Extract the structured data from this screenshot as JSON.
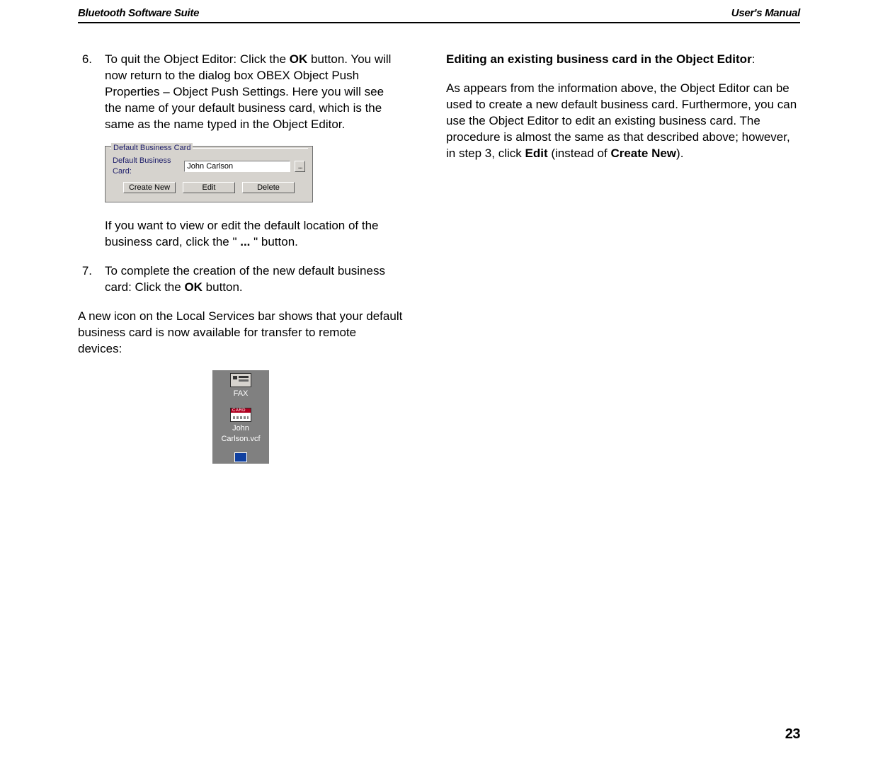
{
  "header": {
    "left": "Bluetooth Software Suite",
    "right": "User's Manual"
  },
  "left": {
    "item6": {
      "num": "6.",
      "text_before_ok": "To quit the Object Editor: Click the ",
      "ok": "OK",
      "text_after_ok": " button. You will now return to the dialog box OBEX Object Push Properties – Object Push Settings. Here you will see the name of your default business card, which is the same as the name typed in the Object Editor."
    },
    "dbc": {
      "group_label": "Default Business Card",
      "field_label": "Default Business Card:",
      "value": "John Carlson",
      "browse": "...",
      "create": "Create New",
      "edit": "Edit",
      "delete": "Delete"
    },
    "para_after_image_before_bold": "If you want to view or edit the default location of the business card, click the \" ",
    "para_after_image_bold": "...",
    "para_after_image_after_bold": " \" button.",
    "item7": {
      "num": "7.",
      "text_before_ok": "To complete the creation of the new default business card: Click the ",
      "ok": "OK",
      "text_after_ok": " button."
    },
    "para_services": "A new icon on the Local Services bar shows that your default business card is now available for transfer to remote devices:",
    "services": {
      "fax": "FAX",
      "card_badge": "CARD",
      "card": "John Carlson.vcf"
    }
  },
  "right": {
    "h_bold": "Editing an existing business card in the Object Editor",
    "h_colon": ":",
    "p_before_edit": "As appears from the information above, the Object Editor can be used to create a new default business card. Furthermore, you can use the Object Editor to edit an existing business card. The procedure is almost the same as that described above; however, in step 3, click ",
    "edit": "Edit",
    "p_mid": " (instead of ",
    "create_new": "Create New",
    "p_after": ")."
  },
  "page_number": "23"
}
